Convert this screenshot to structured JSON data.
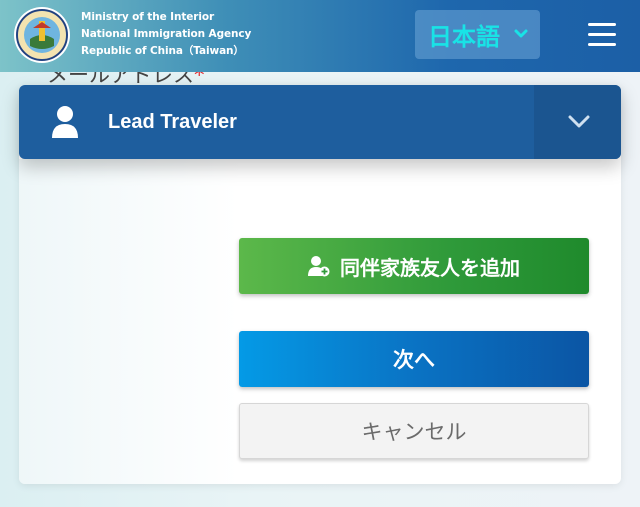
{
  "header": {
    "agency_lines": [
      "Ministry of the Interior",
      "National Immigration Agency",
      "Republic of China（Taiwan）"
    ],
    "language_label": "日本語",
    "logo_icon": "agency-seal-icon",
    "menu_icon": "hamburger-menu-icon",
    "language_color": "#19e3e6"
  },
  "form": {
    "background_field_label": "メールアドレス",
    "required_mark": "*"
  },
  "traveler_section": {
    "title": "Lead Traveler",
    "icon": "person-icon",
    "toggle_icon": "chevron-down-icon"
  },
  "actions": {
    "add_companion_label": "同伴家族友人を追加",
    "next_label": "次へ",
    "cancel_label": "キャンセル"
  },
  "colors": {
    "header_blue": "#1e67ad",
    "card_header": "#1e5e9e",
    "add_button": "#2f9a3a",
    "next_button": "#0a73c4",
    "cancel_button": "#f3f3f3",
    "required": "#e0262a"
  }
}
